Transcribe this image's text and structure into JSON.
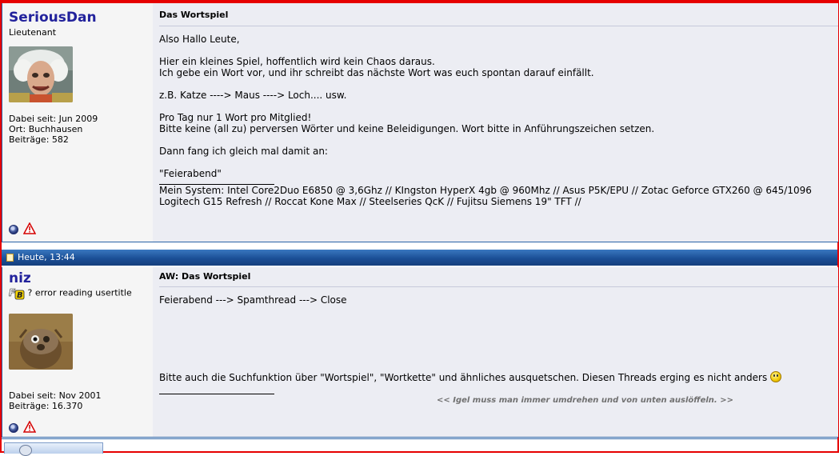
{
  "posts": [
    {
      "username": "SeriousDan",
      "usertitle": "Lieutenant",
      "meta": [
        "Dabei seit: Jun 2009",
        "Ort: Buchhausen",
        "Beiträge: 582"
      ],
      "title": "Das Wortspiel",
      "body": [
        "Also Hallo Leute,",
        "",
        "Hier ein kleines Spiel, hoffentlich wird kein Chaos daraus.",
        "Ich gebe ein Wort vor, und ihr schreibt das nächste Wort was euch spontan darauf einfällt.",
        "",
        "z.B. Katze ----> Maus ----> Loch.... usw.",
        "",
        "Pro Tag nur 1 Wort pro Mitglied!",
        "Bitte keine (all zu) perversen Wörter und keine Beleidigungen. Wort bitte in Anführungszeichen setzen.",
        "",
        "Dann fang ich gleich mal damit an:",
        "",
        "\"Feierabend\""
      ],
      "signature": [
        "Mein System: Intel Core2Duo E6850 @ 3,6Ghz // KIngston HyperX 4gb @ 960Mhz // Asus P5K/EPU // Zotac Geforce GTX260 @ 645/1096",
        "Logitech G15 Refresh // Roccat Kone Max // Steelseries QcK // Fujitsu Siemens 19\" TFT //"
      ],
      "icons": [
        "online-status-icon",
        "report-post-icon"
      ]
    },
    {
      "date": "Heute, 13:44",
      "username": "niz",
      "usertitle": "? error reading usertitle",
      "meta": [
        "Dabei seit: Nov 2001",
        "Beiträge: 16.370"
      ],
      "title": "AW: Das Wortspiel",
      "body_line1": "Feierabend ---> Spamthread ---> Close",
      "body_line2": "Bitte auch die Suchfunktion über \"Wortspiel\", \"Wortkette\" und ähnliches ausquetschen. Diesen Threads erging es nicht anders",
      "signature_text": "<< Igel muss man immer umdrehen und von unten auslöffeln. >>",
      "icons": [
        "online-status-icon",
        "report-post-icon"
      ]
    }
  ],
  "colors": {
    "username": "#22229c",
    "band": "#1b4f96",
    "frame": "#e60000"
  }
}
